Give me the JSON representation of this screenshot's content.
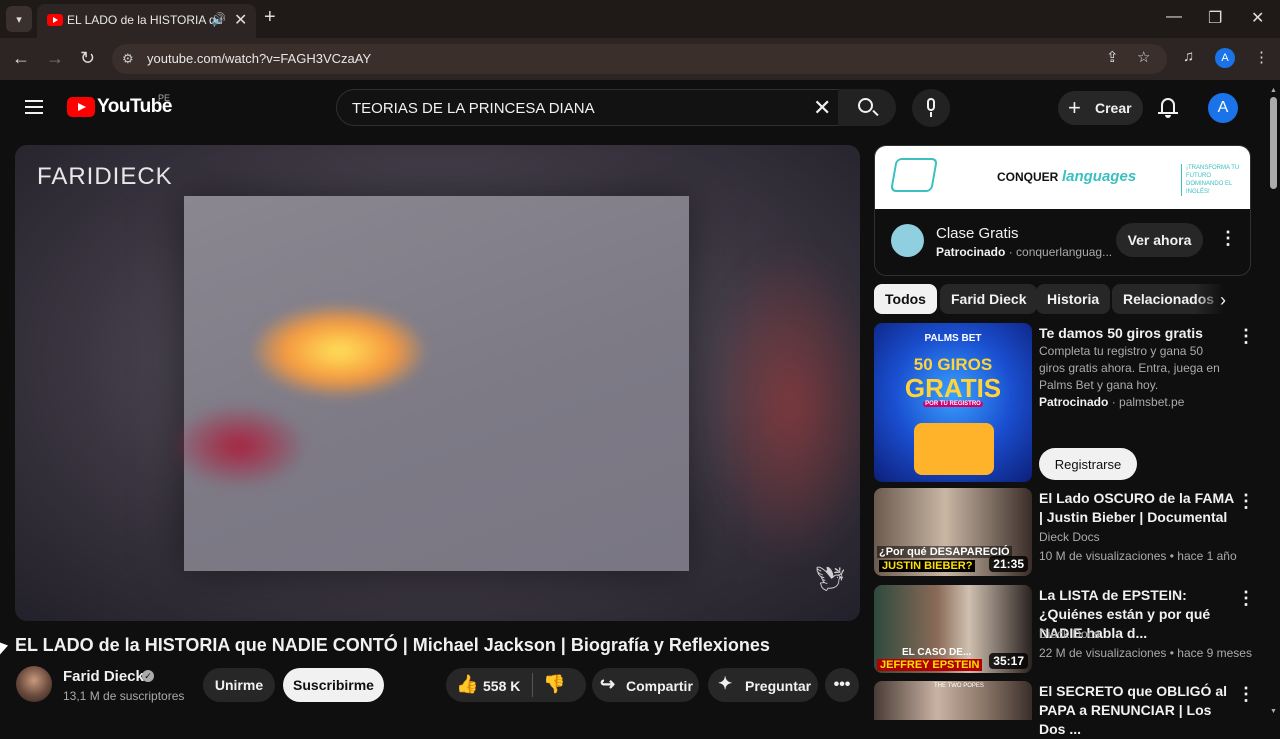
{
  "browser": {
    "tab_title": "EL LADO de la HISTORIA qu",
    "url": "youtube.com/watch?v=FAGH3VCzaAY",
    "profile_initial": "A"
  },
  "header": {
    "logo_text": "YouTube",
    "country_code": "PE",
    "search_query": "TEORIAS DE LA PRINCESA DIANA",
    "create_label": "Crear",
    "avatar_initial": "A"
  },
  "player": {
    "watermark": "FARIDIECK"
  },
  "video": {
    "title": "EL LADO de la HISTORIA que NADIE CONTÓ | Michael Jackson | Biografía y Reflexiones",
    "channel": "Farid Dieck",
    "subscribers": "13,1 M de suscriptores",
    "join_label": "Unirme",
    "subscribe_label": "Suscribirme",
    "likes": "558 K",
    "share_label": "Compartir",
    "ask_label": "Preguntar"
  },
  "sidebar_ad": {
    "brand_prefix": "CONQUER",
    "brand_suffix": "languages",
    "tagline": "¡TRANSFORMA TU FUTURO DOMINANDO EL INGLÉS!",
    "title": "Clase Gratis",
    "sponsored": "Patrocinado",
    "domain": "· conquerlanguag...",
    "cta": "Ver ahora"
  },
  "chips": [
    "Todos",
    "Farid Dieck",
    "Historia",
    "Relacionados"
  ],
  "promo": {
    "title": "Te damos 50 giros gratis",
    "description": "Completa tu registro y gana 50 giros gratis ahora. Entra, juega en Palms Bet y gana hoy.",
    "sponsored": "Patrocinado",
    "domain": "· palmsbet.pe",
    "cta": "Registrarse",
    "thumb_brand": "PALMS BET",
    "thumb_line1": "50 GIROS",
    "thumb_line2": "GRATIS",
    "thumb_line3": "POR TU REGISTRO"
  },
  "recommendations": [
    {
      "title": "El Lado OSCURO de la FAMA | Justin Bieber | Documental",
      "channel": "Dieck Docs",
      "meta": "10 M de visualizaciones • hace 1 año",
      "duration": "21:35",
      "thumb_text_1": "¿Por qué DESAPARECIÓ",
      "thumb_text_2": "JUSTIN BIEBER?"
    },
    {
      "title": "La LISTA de EPSTEIN: ¿Quiénes están y por qué NADIE habla d...",
      "channel": "Dieck Docs",
      "meta": "22 M de visualizaciones • hace 9 meses",
      "duration": "35:17",
      "thumb_text_1": "EL CASO DE...",
      "thumb_text_2": "JEFFREY EPSTEIN"
    },
    {
      "title": "El SECRETO que OBLIGÓ al PAPA a RENUNCIAR | Los Dos ...",
      "thumb_text_1": "THE TWO POPES"
    }
  ]
}
